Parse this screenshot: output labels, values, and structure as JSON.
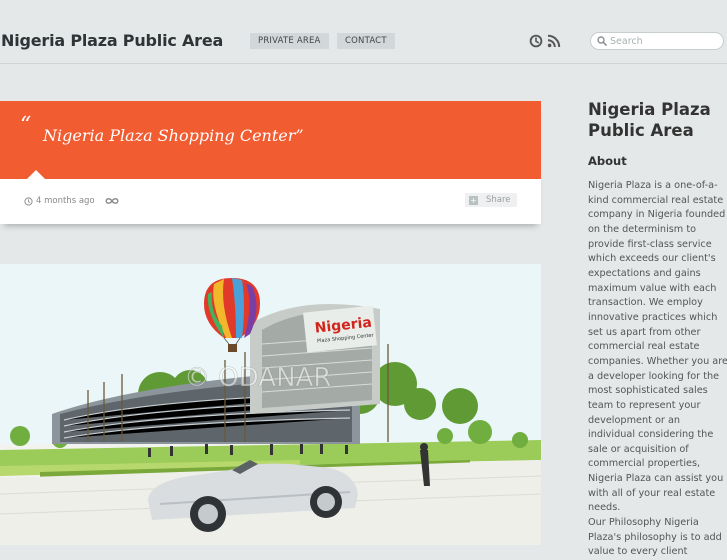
{
  "header": {
    "site_title": "Nigeria Plaza Public Area",
    "nav": [
      "PRIVATE AREA",
      "CONTACT"
    ],
    "icons": [
      "clock-icon",
      "rss-icon"
    ],
    "search": {
      "placeholder": "Search",
      "value": ""
    }
  },
  "post": {
    "title": "Nigeria Plaza Shopping Center",
    "time_ago": "4 months ago",
    "share_label": "Share",
    "banner_color": "#f25c31",
    "image": {
      "sign_text": "Nigeria",
      "sign_subtext": "Plaza Shopping Center",
      "watermark": "© ODANAR"
    }
  },
  "sidebar": {
    "title": "Nigeria Plaza Public Area",
    "about_heading": "About",
    "about_text": "Nigeria Plaza is a one-of-a-kind commercial real estate company in Nigeria founded on the determinism to provide first-class service which exceeds our client's expectations and gains maximum value with each transaction. We employ innovative practices which set us apart from other commercial real estate companies. Whether you are a developer looking for the most sophisticated sales team to represent your development or an individual considering the sale or acquisition of commercial properties, Nigeria Plaza can assist you with all of your real estate needs.",
    "about_text_2": "Our Philosophy Nigeria Plaza's philosophy is to add value to every client"
  }
}
